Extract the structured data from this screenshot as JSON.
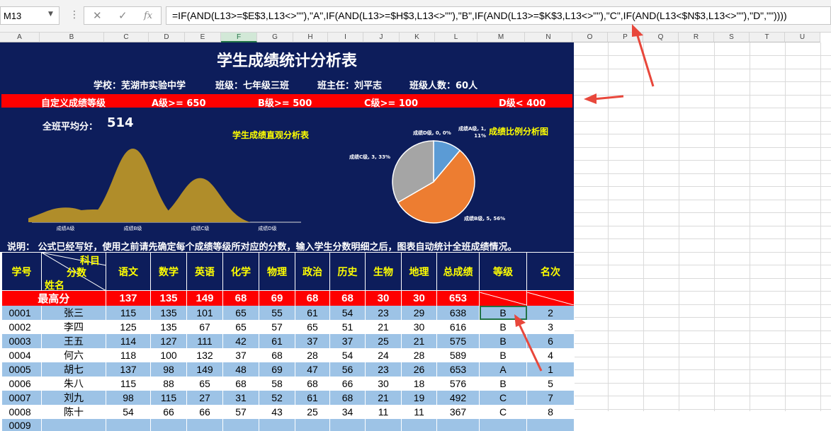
{
  "namebox": "M13",
  "formula": "=IF(AND(L13>=$E$3,L13<>\"\"),\"A\",IF(AND(L13>=$H$3,L13<>\"\"),\"B\",IF(AND(L13>=$K$3,L13<>\"\"),\"C\",IF(AND(L13<$N$3,L13<>\"\"),\"D\",\"\"))))",
  "columns": [
    "A",
    "B",
    "C",
    "D",
    "E",
    "F",
    "G",
    "H",
    "I",
    "J",
    "K",
    "L",
    "M",
    "N",
    "O",
    "P",
    "Q",
    "R",
    "S",
    "T",
    "U"
  ],
  "title": "学生成绩统计分析表",
  "school": "学校：芜湖市实验中学",
  "class_name": "班级：七年级三班",
  "teacher": "班主任：刘平志",
  "count": "班级人数：60人",
  "grade_bar": {
    "label": "自定义成绩等级",
    "a": "A级>= 650",
    "b": "B级>= 500",
    "c": "C级>= 100",
    "d": "D级< 400"
  },
  "avg_label": "全班平均分：",
  "avg_value": "514",
  "area_chart": {
    "title": "学生成绩直观分析表"
  },
  "pie_title": "成绩比例分析图",
  "chart_data": [
    {
      "type": "area",
      "title": "学生成绩直观分析表",
      "categories": [
        "成绩A级",
        "成绩B级",
        "成绩C级",
        "成绩D级"
      ],
      "values": [
        1,
        5,
        3,
        0
      ],
      "grid": false
    },
    {
      "type": "pie",
      "title": "成绩比例分析图",
      "labels": [
        "成绩A级",
        "成绩B级",
        "成绩C级",
        "成绩D级"
      ],
      "values": [
        1,
        5,
        3,
        0
      ],
      "percent": [
        "11%",
        "56%",
        "33%",
        "0%"
      ],
      "colors": [
        "#5b9bd5",
        "#ed7d31",
        "#a5a5a5",
        "#ffc000"
      ],
      "data_labels": [
        "成绩A级, 1, 11%",
        "成绩B级, 5, 56%",
        "成绩C级, 3, 33%",
        "成绩D级, 0, 0%"
      ]
    }
  ],
  "note": "说明：  公式已经写好，使用之前请先确定每个成绩等级所对应的分数，输入学生分数明细之后，图表自动统计全班成绩情况。",
  "table": {
    "h_id": "学号",
    "h_subject": "科目",
    "h_score": "分数",
    "h_name": "姓名",
    "subjects": [
      "语文",
      "数学",
      "英语",
      "化学",
      "物理",
      "政治",
      "历史",
      "生物",
      "地理",
      "总成绩",
      "等级",
      "名次"
    ],
    "max_label": "最高分",
    "max": [
      "137",
      "135",
      "149",
      "68",
      "69",
      "68",
      "68",
      "30",
      "30",
      "653"
    ],
    "rows": [
      {
        "id": "0001",
        "name": "张三",
        "s": [
          "115",
          "135",
          "101",
          "65",
          "55",
          "61",
          "54",
          "23",
          "29",
          "638"
        ],
        "grade": "B",
        "rank": "2"
      },
      {
        "id": "0002",
        "name": "李四",
        "s": [
          "125",
          "135",
          "67",
          "65",
          "57",
          "65",
          "51",
          "21",
          "30",
          "616"
        ],
        "grade": "B",
        "rank": "3"
      },
      {
        "id": "0003",
        "name": "王五",
        "s": [
          "114",
          "127",
          "111",
          "42",
          "61",
          "37",
          "37",
          "25",
          "21",
          "575"
        ],
        "grade": "B",
        "rank": "6"
      },
      {
        "id": "0004",
        "name": "何六",
        "s": [
          "118",
          "100",
          "132",
          "37",
          "68",
          "28",
          "54",
          "24",
          "28",
          "589"
        ],
        "grade": "B",
        "rank": "4"
      },
      {
        "id": "0005",
        "name": "胡七",
        "s": [
          "137",
          "98",
          "149",
          "48",
          "69",
          "47",
          "56",
          "23",
          "26",
          "653"
        ],
        "grade": "A",
        "rank": "1"
      },
      {
        "id": "0006",
        "name": "朱八",
        "s": [
          "115",
          "88",
          "65",
          "68",
          "58",
          "68",
          "66",
          "30",
          "18",
          "576"
        ],
        "grade": "B",
        "rank": "5"
      },
      {
        "id": "0007",
        "name": "刘九",
        "s": [
          "98",
          "115",
          "27",
          "31",
          "52",
          "61",
          "68",
          "21",
          "19",
          "492"
        ],
        "grade": "C",
        "rank": "7"
      },
      {
        "id": "0008",
        "name": "陈十",
        "s": [
          "54",
          "66",
          "66",
          "57",
          "43",
          "25",
          "34",
          "11",
          "11",
          "367"
        ],
        "grade": "C",
        "rank": "8"
      },
      {
        "id": "0009",
        "name": "",
        "s": [
          "",
          "",
          "",
          "",
          "",
          "",
          "",
          "",
          "",
          ""
        ],
        "grade": "",
        "rank": ""
      }
    ]
  }
}
